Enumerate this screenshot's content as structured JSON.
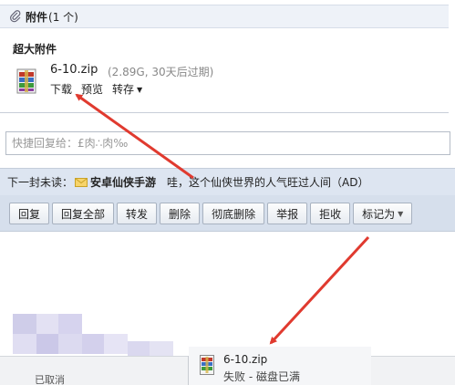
{
  "attachments": {
    "title": "附件",
    "count_text": "(1 个)",
    "section_title": "超大附件",
    "file": {
      "name": "6-10.zip",
      "meta": "(2.89G, 30天后过期)",
      "actions": [
        "下载",
        "预览",
        "转存"
      ]
    }
  },
  "quick_reply": {
    "placeholder": "快捷回复给：£肉∴肉‰"
  },
  "next_mail": {
    "label": "下一封未读：",
    "subject": "安卓仙侠手游",
    "snippet": "哇，这个仙侠世界的人气旺过人间（AD）"
  },
  "toolbar": {
    "buttons": [
      "回复",
      "回复全部",
      "转发",
      "删除",
      "彻底删除",
      "举报",
      "拒收",
      "标记为"
    ]
  },
  "downloads": {
    "left_text": "已取消",
    "item": {
      "name": "6-10.zip",
      "status": "失败 - 磁盘已满"
    }
  },
  "colors": {
    "arrow": "#e03a2f",
    "toolbar_bg": "#d6dfec",
    "next_bar_bg": "#dde5f1"
  }
}
